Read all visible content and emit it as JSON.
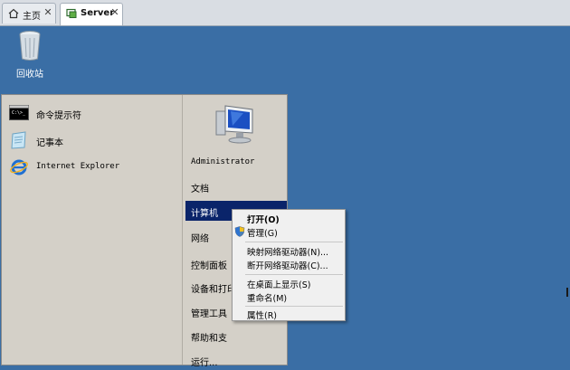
{
  "tabs": [
    {
      "label": "主页",
      "icon": "home-icon",
      "active": false
    },
    {
      "label": "Server",
      "icon": "vm-icon",
      "active": true
    }
  ],
  "desktop": {
    "recycle_label": "回收站",
    "background_color": "#3a6ea5"
  },
  "start_menu": {
    "programs": [
      {
        "label": "命令提示符",
        "icon": "cmd-icon"
      },
      {
        "label": "记事本",
        "icon": "notepad-icon"
      },
      {
        "label": "Internet Explorer",
        "icon": "ie-icon"
      }
    ],
    "right_items": [
      {
        "label": "Administrator"
      },
      {
        "label": "文档"
      },
      {
        "label": "计算机"
      },
      {
        "label": "网络"
      },
      {
        "label": "控制面板"
      },
      {
        "label": "设备和打印"
      },
      {
        "label": "管理工具"
      },
      {
        "label": "帮助和支"
      },
      {
        "label": "运行..."
      }
    ]
  },
  "context_menu": {
    "items": [
      {
        "label": "打开(O)"
      },
      {
        "label": "管理(G)"
      },
      {
        "label": "映射网络驱动器(N)..."
      },
      {
        "label": "断开网络驱动器(C)..."
      },
      {
        "label": "在桌面上显示(S)"
      },
      {
        "label": "重命名(M)"
      },
      {
        "label": "属性(R)"
      }
    ]
  },
  "colors": {
    "highlight": "#0a246a",
    "menu_bg": "#d4d0c8",
    "context_bg": "#f0f0f0"
  }
}
